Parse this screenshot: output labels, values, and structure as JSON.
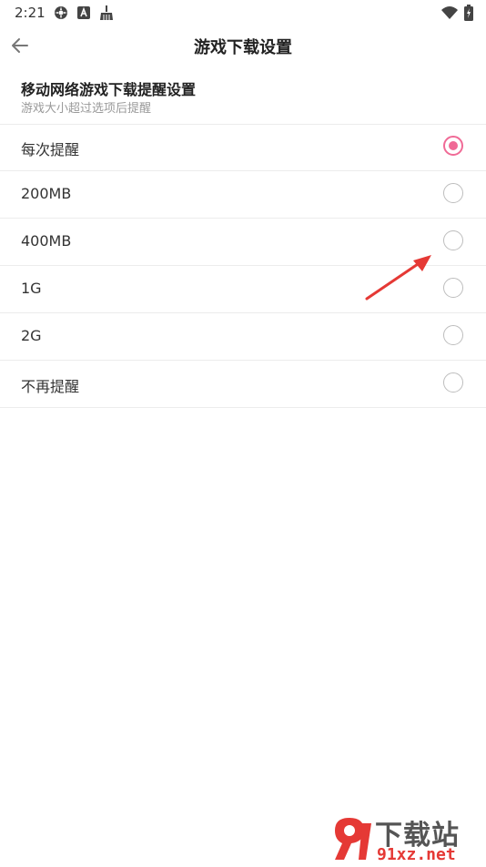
{
  "status_bar": {
    "time": "2:21",
    "left_icons": [
      "vpn-key-icon",
      "a-badge-icon",
      "cleaner-broom-icon"
    ],
    "right_icons": [
      "wifi-icon",
      "battery-charging-icon"
    ]
  },
  "app_bar": {
    "back_icon": "arrow-left-icon",
    "title": "游戏下载设置"
  },
  "section": {
    "title": "移动网络游戏下载提醒设置",
    "subtitle": "游戏大小超过选项后提醒"
  },
  "options": [
    {
      "label": "每次提醒",
      "checked": true
    },
    {
      "label": "200MB",
      "checked": false
    },
    {
      "label": "400MB",
      "checked": false
    },
    {
      "label": "1G",
      "checked": false
    },
    {
      "label": "2G",
      "checked": false
    },
    {
      "label": "不再提醒",
      "checked": false
    }
  ],
  "colors": {
    "accent": "#f06a96",
    "annotation_arrow": "#e53935"
  },
  "watermark": {
    "top": "下载站",
    "bottom": "91xz.net"
  }
}
